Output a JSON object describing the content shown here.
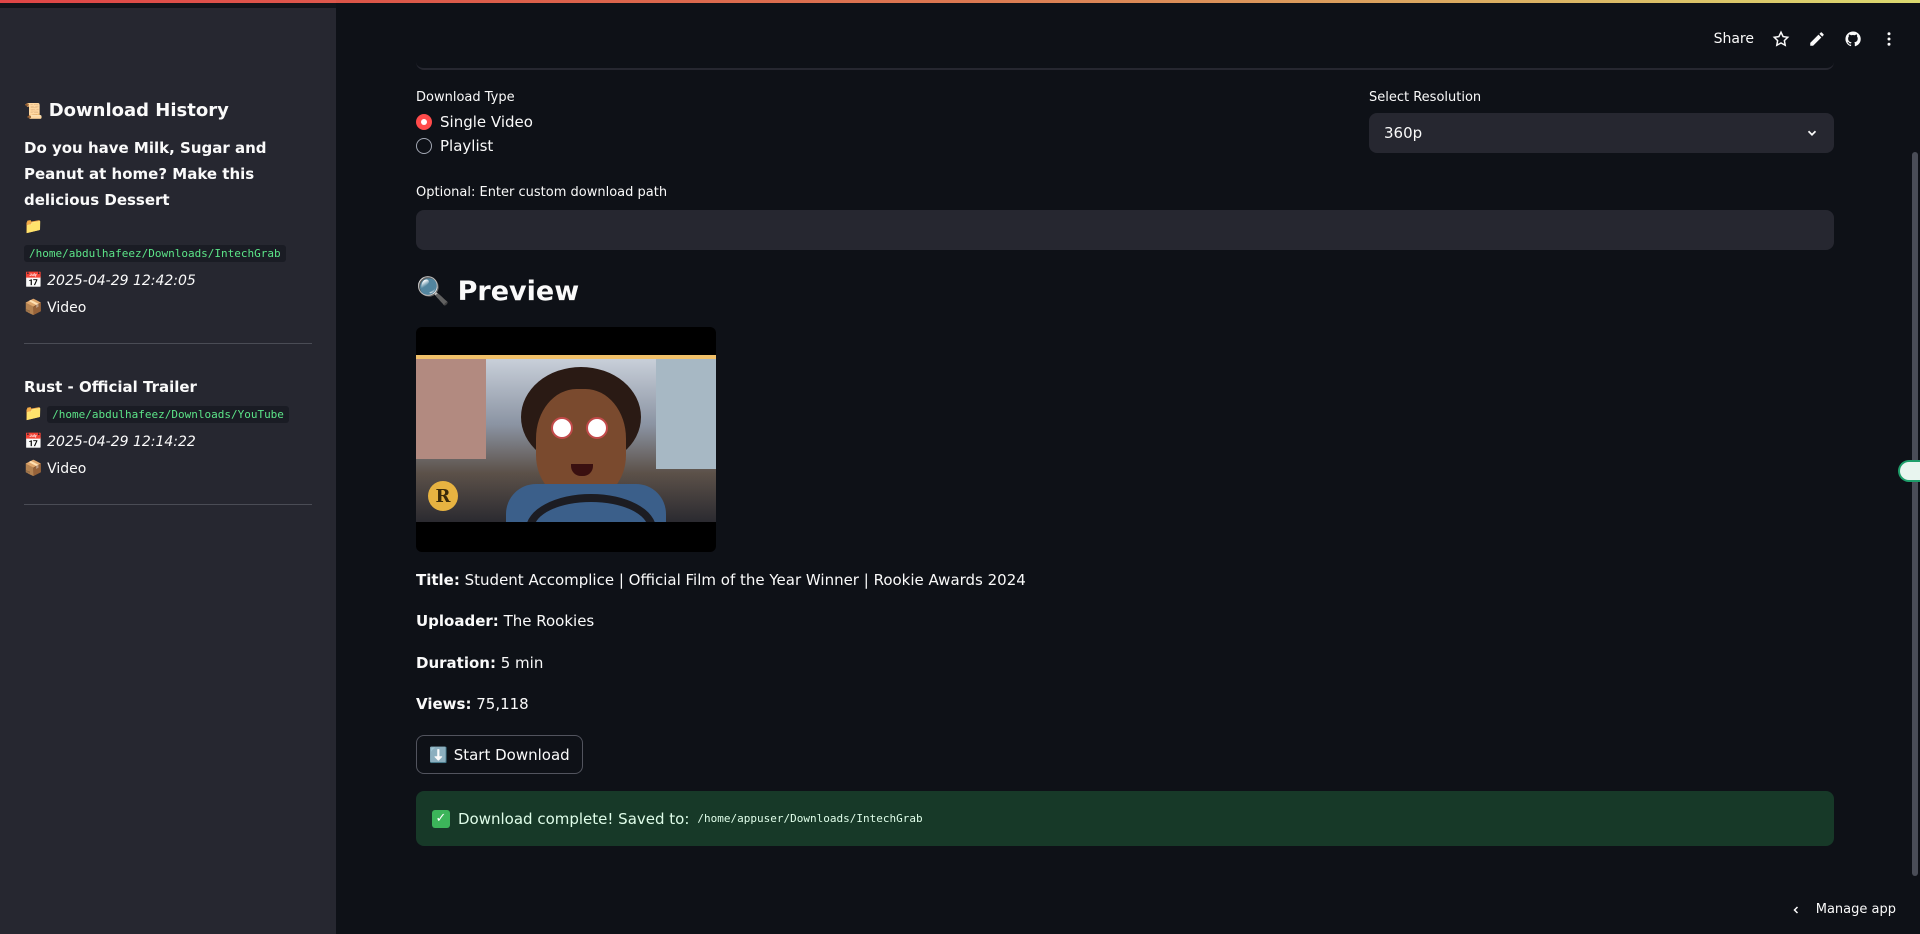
{
  "sidebar": {
    "heading": "Download History",
    "heading_icon": "scroll-icon",
    "entries": [
      {
        "title": "Do you have Milk, Sugar and Peanut at home? Make this delicious Dessert",
        "path": "/home/abdulhafeez/Downloads/IntechGrab",
        "date": "2025-04-29 12:42:05",
        "type": "Video"
      },
      {
        "title": "Rust - Official Trailer",
        "path": "/home/abdulhafeez/Downloads/YouTube",
        "date": "2025-04-29 12:14:22",
        "type": "Video"
      }
    ]
  },
  "toolbar": {
    "share_label": "Share",
    "icons": [
      "star-icon",
      "pencil-icon",
      "github-icon",
      "more-vert-icon"
    ]
  },
  "form": {
    "download_type_label": "Download Type",
    "options": [
      "Single Video",
      "Playlist"
    ],
    "selected_option": "Single Video",
    "resolution_label": "Select Resolution",
    "resolution_value": "360p",
    "path_label": "Optional: Enter custom download path",
    "path_value": ""
  },
  "preview": {
    "heading": "Preview",
    "heading_icon": "magnifier-icon",
    "title_label": "Title:",
    "title_value": "Student Accomplice | Official Film of the Year Winner | Rookie Awards 2024",
    "uploader_label": "Uploader:",
    "uploader_value": "The Rookies",
    "duration_label": "Duration:",
    "duration_value": "5 min",
    "views_label": "Views:",
    "views_value": "75,118",
    "thumbnail_badge": "R"
  },
  "actions": {
    "start_download_label": "Start Download"
  },
  "status": {
    "message": "Download complete! Saved to:",
    "path": "/home/appuser/Downloads/IntechGrab"
  },
  "footer": {
    "manage_app_label": "Manage app"
  },
  "colors": {
    "background": "#0e1117",
    "sidebar": "#262730",
    "accent": "#ff4b4b",
    "success_bg": "#173928",
    "code_green": "#5ce488"
  }
}
